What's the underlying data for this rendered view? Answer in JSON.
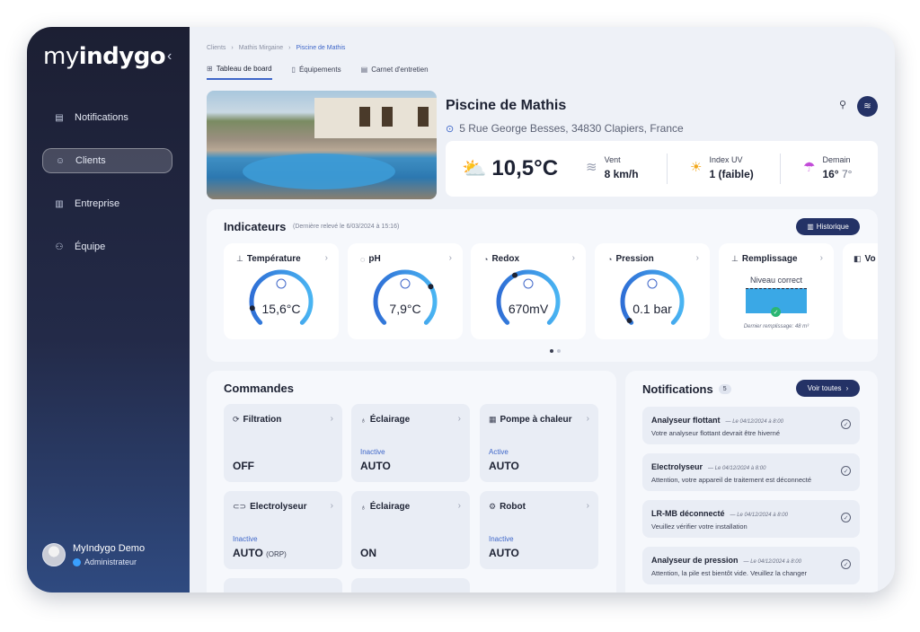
{
  "sidebar": {
    "logo_light": "my",
    "logo_bold": "indygo",
    "collapse_icon": "‹",
    "items": [
      {
        "label": "Notifications",
        "icon": "clipboard-icon"
      },
      {
        "label": "Clients",
        "icon": "users-icon"
      },
      {
        "label": "Entreprise",
        "icon": "building-icon"
      },
      {
        "label": "Équipe",
        "icon": "team-icon"
      }
    ],
    "user": {
      "name": "MyIndygo Demo",
      "role": "Administrateur"
    }
  },
  "breadcrumb": [
    "Clients",
    "Mathis Mirgaine",
    "Piscine de Mathis"
  ],
  "tabs": [
    {
      "label": "Tableau de board",
      "active": true
    },
    {
      "label": "Équipements"
    },
    {
      "label": "Carnet d'entretien"
    }
  ],
  "pool": {
    "title": "Piscine de Mathis",
    "address": "5 Rue George Besses, 34830 Clapiers, France"
  },
  "weather": {
    "temperature": "10,5°C",
    "wind_label": "Vent",
    "wind_value": "8 km/h",
    "uv_label": "Index UV",
    "uv_value": "1 (faible)",
    "tomorrow_label": "Demain",
    "tomorrow_high": "16°",
    "tomorrow_low": "7°"
  },
  "indicators": {
    "title": "Indicateurs",
    "subtitle": "(Dernière relevé le 6/03/2024 à 15:16)",
    "history_button": "Historique",
    "cards": [
      {
        "label": "Température",
        "value": "15,6°C",
        "marker": 0.12
      },
      {
        "label": "pH",
        "value": "7,9°C",
        "marker": 0.72
      },
      {
        "label": "Redox",
        "value": "670mV",
        "marker": 0.4
      },
      {
        "label": "Pression",
        "value": "0.1 bar",
        "marker": 0.02
      }
    ],
    "fill": {
      "label": "Remplissage",
      "status": "Niveau correct",
      "note": "Dernier remplissage: 48 m³"
    },
    "partial_label": "Vo"
  },
  "commands": {
    "title": "Commandes",
    "cards": [
      {
        "label": "Filtration",
        "status": "",
        "value": "OFF",
        "sub": ""
      },
      {
        "label": "Éclairage",
        "status": "Inactive",
        "value": "AUTO",
        "sub": ""
      },
      {
        "label": "Pompe à chaleur",
        "status": "Active",
        "value": "AUTO",
        "sub": ""
      },
      {
        "label": "Electrolyseur",
        "status": "Inactive",
        "value": "AUTO",
        "sub": "(ORP)"
      },
      {
        "label": "Éclairage",
        "status": "",
        "value": "ON",
        "sub": ""
      },
      {
        "label": "Robot",
        "status": "Inactive",
        "value": "AUTO",
        "sub": ""
      }
    ]
  },
  "notifications": {
    "title": "Notifications",
    "count": "5",
    "all_button": "Voir toutes",
    "items": [
      {
        "title": "Analyseur flottant",
        "date": "Le 04/12/2024 à 8:00",
        "desc": "Votre analyseur flottant devrait être hiverné"
      },
      {
        "title": "Electrolyseur",
        "date": "Le 04/12/2024 à 8:00",
        "desc": "Attention, votre appareil de traitement est déconnecté"
      },
      {
        "title": "LR-MB déconnecté",
        "date": "Le 04/12/2024 à 8:00",
        "desc": "Veuillez vérifier votre installation"
      },
      {
        "title": "Analyseur de pression",
        "date": "Le 04/12/2024 à 8:00",
        "desc": "Attention, la pile est bientôt vide. Veuillez la changer"
      }
    ]
  }
}
